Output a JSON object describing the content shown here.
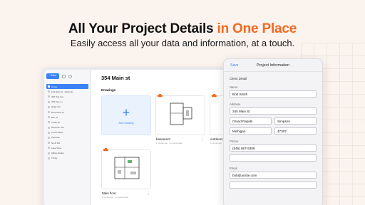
{
  "hero": {
    "title_main": "All Your Project Details ",
    "title_accent": "in One Place",
    "subtitle": "Easily access all your data and information, at a touch."
  },
  "colors": {
    "accent": "#f26a1f",
    "primary": "#3b82f6"
  },
  "sidebar": {
    "new_label": "+ New",
    "items": [
      {
        "label": "Home",
        "active": true
      },
      {
        "label": "123 Main St - Estimate",
        "active": false
      },
      {
        "label": "456 Oak Ave",
        "active": false
      },
      {
        "label": "789 Pine Ln",
        "active": false
      },
      {
        "label": "Ridge Rd",
        "active": false
      },
      {
        "label": "Brookview St",
        "active": false
      },
      {
        "label": "Elm Ct",
        "active": false
      },
      {
        "label": "Cedar Dr",
        "active": false
      },
      {
        "label": "Hampton Ave",
        "active": false
      },
      {
        "label": "Lincoln Blvd",
        "active": false
      },
      {
        "label": "Park Ave",
        "active": false
      },
      {
        "label": "North Rd",
        "active": false
      },
      {
        "label": "Lake View",
        "active": false
      },
      {
        "label": "Hilltop Estate",
        "active": false
      },
      {
        "label": "Trinity",
        "active": false
      }
    ]
  },
  "main": {
    "title": "354 Main st",
    "section": "Drawings",
    "new_drawing": "New Drawing",
    "cards": [
      {
        "name": "basement",
        "meta": "1 minute ago · not geolocated"
      },
      {
        "name": "outdoors",
        "meta": "1 minute ago"
      },
      {
        "name": "Main floor",
        "meta": "1 minute ago · not geolocated"
      }
    ]
  },
  "panel": {
    "save": "Save",
    "title": "Project Information",
    "section": "Client Detail",
    "name_label": "Name",
    "name_value": "Bob Smith",
    "address_label": "Address",
    "street": "345 Main St",
    "city": "Grand Rapids",
    "county": "Simpson",
    "state": "Michigan",
    "zip": "47302",
    "phone_label": "Phone",
    "phone": "(546) 867-5309",
    "email_label": "Email",
    "email": "bob@acsite.com"
  }
}
